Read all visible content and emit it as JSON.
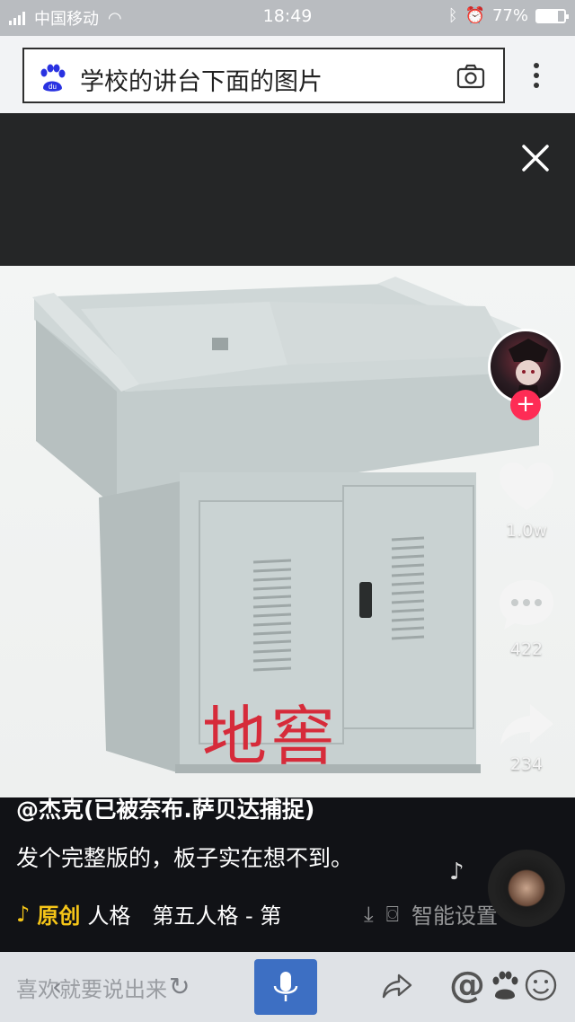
{
  "status_bar": {
    "carrier": "中国移动",
    "network": "2G",
    "time": "18:49",
    "battery": "77%",
    "battery_level": 0.77
  },
  "search": {
    "query": "学校的讲台下面的图片"
  },
  "photo": {
    "watermark_text": "地窖"
  },
  "rail": {
    "likes": "1.0w",
    "comments": "422",
    "shares": "234"
  },
  "post": {
    "author": "@杰克(已被奈布.萨贝达捕捉)",
    "description": "发个完整版的，板子实在想不到。",
    "music_original_label": "原创",
    "music_title": "人格　第五人格 - 第",
    "smart_bg_label": "智能设置"
  },
  "bottom_bar": {
    "comment_placeholder": "喜欢就要说出来"
  },
  "colors": {
    "like_accent": "#fe2c55",
    "music_accent": "#f5c518",
    "mic_button": "#3d6fc3"
  }
}
